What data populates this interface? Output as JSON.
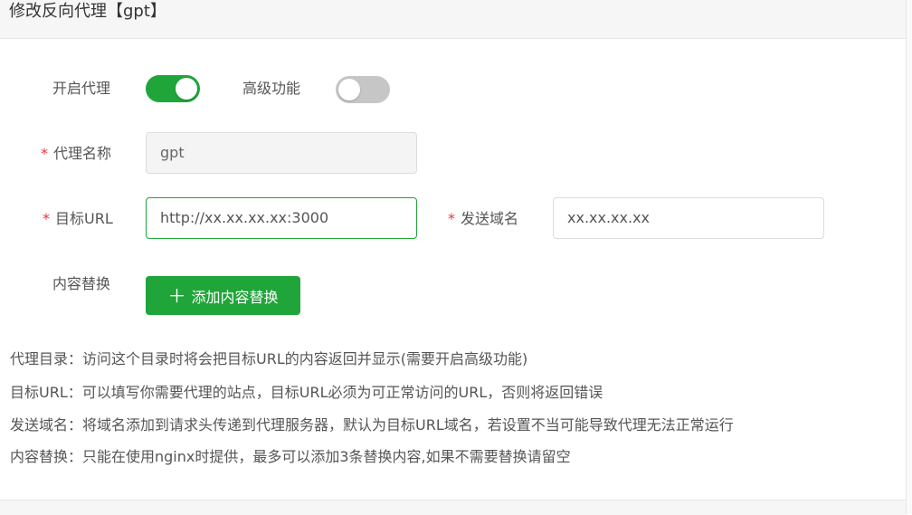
{
  "dialog": {
    "title": "修改反向代理【gpt】"
  },
  "form": {
    "enable_proxy_label": "开启代理",
    "enable_proxy_on": true,
    "advanced_label": "高级功能",
    "advanced_on": false,
    "required_mark": "*",
    "proxy_name_label": "代理名称",
    "proxy_name_value": "gpt",
    "target_url_label": "目标URL",
    "target_url_value": "http://xx.xx.xx.xx:3000",
    "send_domain_label": "发送域名",
    "send_domain_value": "xx.xx.xx.xx",
    "content_replace_label": "内容替换",
    "add_replace_button": "添加内容替换",
    "plus_glyph": "＋"
  },
  "help": [
    "代理目录：访问这个目录时将会把目标URL的内容返回并显示(需要开启高级功能)",
    "目标URL：可以填写你需要代理的站点，目标URL必须为可正常访问的URL，否则将返回错误",
    "发送域名：将域名添加到请求头传递到代理服务器，默认为目标URL域名，若设置不当可能导致代理无法正常运行",
    "内容替换：只能在使用nginx时提供，最多可以添加3条替换内容,如果不需要替换请留空"
  ],
  "colors": {
    "accent": "#20a53a",
    "required": "#e53935",
    "toggle_off": "#c6c6c6"
  }
}
